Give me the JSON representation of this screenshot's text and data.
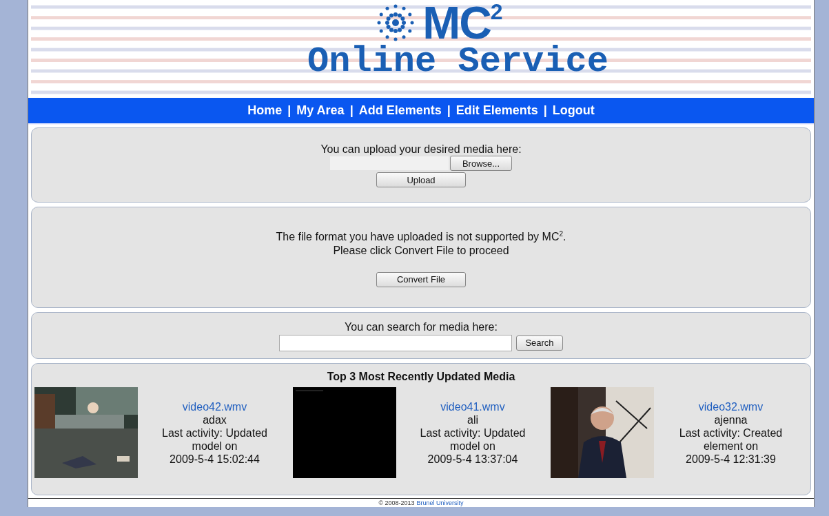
{
  "banner": {
    "logo": "MC$^{2}$",
    "tagline": "Online Service"
  },
  "nav": {
    "items": [
      {
        "label": "Home"
      },
      {
        "label": "My Area"
      },
      {
        "label": "Add Elements"
      },
      {
        "label": "Edit Elements"
      },
      {
        "label": "Logout"
      }
    ],
    "separators": [
      "|",
      "|",
      "|",
      "|"
    ]
  },
  "upload": {
    "prompt": "You can upload your desired media here:",
    "browse_button": "Browse...",
    "upload_button": "Upload"
  },
  "convert": {
    "message": "The file format you have uploaded is not supported by MC$^{2}$.",
    "instruction": "Please click Convert File to proceed",
    "button": "Convert File"
  },
  "search": {
    "prompt": "You can search for media here:",
    "button": "Search"
  },
  "recent": {
    "title": "Top 3 Most Recently Updated Media",
    "items": [
      {
        "file": "video42.wmv",
        "user": "adax",
        "activity": "Last activity: Updated",
        "activity_2": "model on",
        "date": "2009-5-4 15:02:44"
      },
      {
        "file": "video41.wmv",
        "user": "ali",
        "activity": "Last activity: Updated",
        "activity_2": "model on",
        "date": "2009-5-4 13:37:04"
      },
      {
        "file": "video32.wmv",
        "user": "ajenna",
        "activity": "Last activity: Created",
        "activity_2": "element on",
        "date": "2009-5-4 12:31:39"
      }
    ]
  },
  "footer": {
    "copyright": "© 2008-2013",
    "link": "Brunel University"
  }
}
